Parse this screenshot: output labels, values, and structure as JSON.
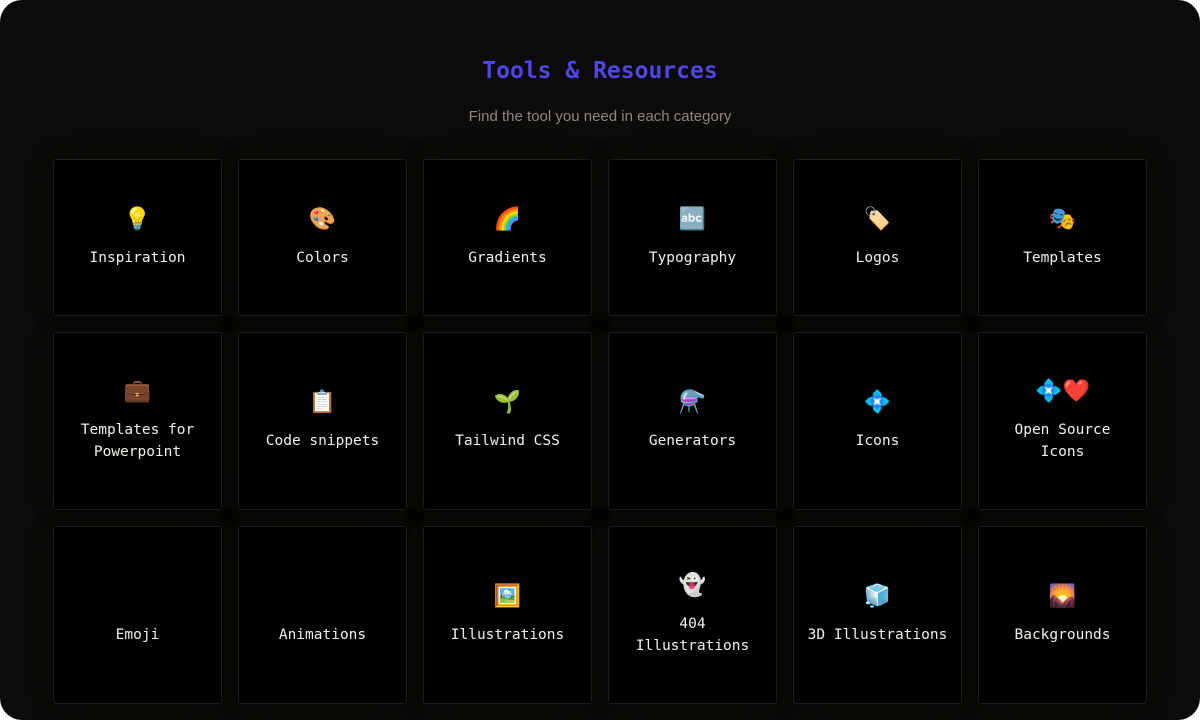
{
  "header": {
    "title": "Tools & Resources",
    "subtitle": "Find the tool you need in each category"
  },
  "colors": {
    "accent": "#4f46e5",
    "background": "#0c0b09",
    "card": "#000000"
  },
  "categories": [
    {
      "label": "Inspiration",
      "icon": "💡",
      "icon_name": "lightbulb-icon"
    },
    {
      "label": "Colors",
      "icon": "🎨",
      "icon_name": "palette-icon"
    },
    {
      "label": "Gradients",
      "icon": "🌈",
      "icon_name": "rainbow-icon"
    },
    {
      "label": "Typography",
      "icon": "🔤",
      "icon_name": "abc-icon"
    },
    {
      "label": "Logos",
      "icon": "🏷️",
      "icon_name": "label-tag-icon"
    },
    {
      "label": "Templates",
      "icon": "🎭",
      "icon_name": "performing-arts-icon"
    },
    {
      "label": "Templates for Powerpoint",
      "icon": "💼",
      "icon_name": "briefcase-icon"
    },
    {
      "label": "Code snippets",
      "icon": "📋",
      "icon_name": "clipboard-icon"
    },
    {
      "label": "Tailwind CSS",
      "icon": "🌱",
      "icon_name": "seedling-icon"
    },
    {
      "label": "Generators",
      "icon": "⚗️",
      "icon_name": "alembic-icon"
    },
    {
      "label": "Icons",
      "icon": "💠",
      "icon_name": "diamond-icon"
    },
    {
      "label": "Open Source Icons",
      "icon": "💠❤️",
      "icon_name": "diamond-heart-icon"
    },
    {
      "label": "Emoji",
      "icon": "😀",
      "icon_name": "grinning-face-icon"
    },
    {
      "label": "Animations",
      "icon": "⚡",
      "icon_name": "lightning-icon"
    },
    {
      "label": "Illustrations",
      "icon": "🖼️",
      "icon_name": "framed-picture-icon"
    },
    {
      "label": "404 Illustrations",
      "icon": "👻",
      "icon_name": "ghost-icon"
    },
    {
      "label": "3D Illustrations",
      "icon": "🧊",
      "icon_name": "ice-cube-icon"
    },
    {
      "label": "Backgrounds",
      "icon": "🌄",
      "icon_name": "sunrise-mountains-icon"
    }
  ]
}
